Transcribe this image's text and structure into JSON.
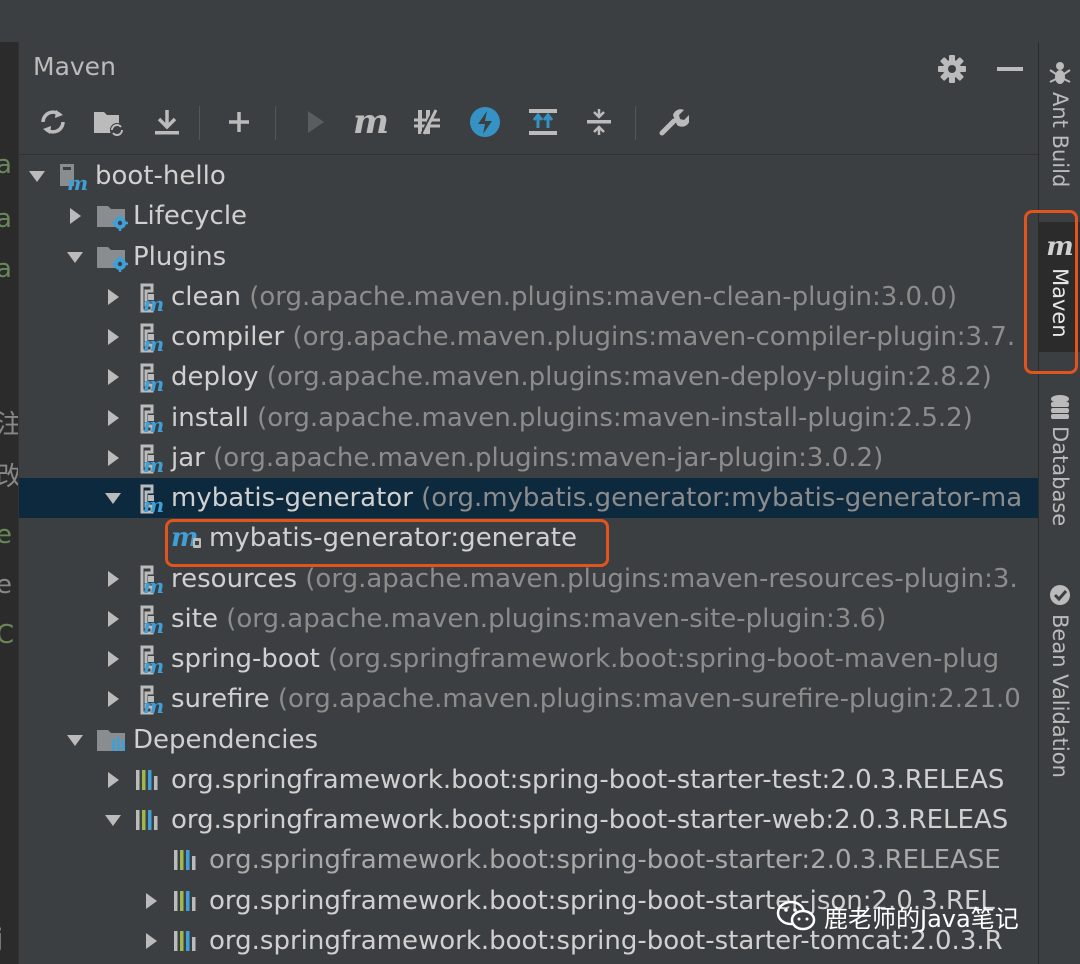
{
  "panel": {
    "title": "Maven"
  },
  "toolbar": {
    "items": [
      "reload-icon",
      "generate-sources-icon",
      "download-icon",
      "add-icon",
      "run-icon",
      "maven-goal-icon",
      "skip-tests-icon",
      "offline-icon",
      "show-dependencies-icon",
      "collapse-all-icon",
      "settings-wrench-icon"
    ],
    "maven_label": "m"
  },
  "tree": {
    "project": "boot-hello",
    "lifecycle": "Lifecycle",
    "plugins": "Plugins",
    "plugin_rows": [
      {
        "name": "clean",
        "coords": "(org.apache.maven.plugins:maven-clean-plugin:3.0.0)"
      },
      {
        "name": "compiler",
        "coords": "(org.apache.maven.plugins:maven-compiler-plugin:3.7."
      },
      {
        "name": "deploy",
        "coords": "(org.apache.maven.plugins:maven-deploy-plugin:2.8.2)"
      },
      {
        "name": "install",
        "coords": "(org.apache.maven.plugins:maven-install-plugin:2.5.2)"
      },
      {
        "name": "jar",
        "coords": "(org.apache.maven.plugins:maven-jar-plugin:3.0.2)"
      },
      {
        "name": "mybatis-generator",
        "coords": "(org.mybatis.generator:mybatis-generator-ma"
      },
      {
        "name": "resources",
        "coords": "(org.apache.maven.plugins:maven-resources-plugin:3."
      },
      {
        "name": "site",
        "coords": "(org.apache.maven.plugins:maven-site-plugin:3.6)"
      },
      {
        "name": "spring-boot",
        "coords": "(org.springframework.boot:spring-boot-maven-plug"
      },
      {
        "name": "surefire",
        "coords": "(org.apache.maven.plugins:maven-surefire-plugin:2.21.0"
      }
    ],
    "goal": "mybatis-generator:generate",
    "dependencies": "Dependencies",
    "dep_rows": [
      "org.springframework.boot:spring-boot-starter-test:2.0.3.RELEAS",
      "org.springframework.boot:spring-boot-starter-web:2.0.3.RELEAS",
      "org.springframework.boot:spring-boot-starter:2.0.3.RELEASE",
      "org.springframework.boot:spring-boot-starter-json:2.0.3.REL",
      "org.springframework.boot:spring-boot-starter-tomcat:2.0.3.R"
    ]
  },
  "right_stripe": {
    "ant": "Ant Build",
    "maven": "Maven",
    "maven_icon": "m",
    "database": "Database",
    "bean": "Bean Validation"
  },
  "watermark": {
    "text": "鹿老师的Java笔记"
  },
  "editor_edge": [
    "a",
    "a",
    "a",
    "注",
    "改",
    "e",
    "e",
    "C",
    "j"
  ],
  "colors": {
    "highlight": "#e0541d",
    "selection": "#0d293e",
    "maven_blue": "#3f9fd6",
    "accent_blue": "#3592c4"
  }
}
